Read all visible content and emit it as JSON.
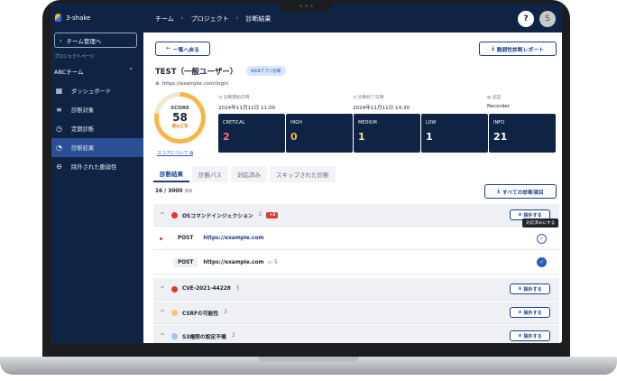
{
  "app": {
    "name": "3-shake"
  },
  "sidebar": {
    "back_label": "チーム管理へ",
    "project_page_label": "プロジェクトページ",
    "team_name": "ABCチーム",
    "items": [
      {
        "label": "ダッシュボード",
        "icon": "dashboard-icon"
      },
      {
        "label": "診断対象",
        "icon": "target-list-icon"
      },
      {
        "label": "定期診断",
        "icon": "clock-icon"
      },
      {
        "label": "診断結果",
        "icon": "pie-chart-icon",
        "active": true
      },
      {
        "label": "除外された脆弱性",
        "icon": "minus-circle-icon"
      }
    ]
  },
  "header": {
    "breadcrumb": [
      "チーム",
      "プロジェクト",
      "診断結果"
    ],
    "help": "?",
    "avatar": "S"
  },
  "main": {
    "back_button": "一覧へ戻る",
    "report_button": "脆弱性診断レポート",
    "title": "TEST（一般ユーザー）",
    "tag": "WEBアプリ診断",
    "url": "https://example.com/login",
    "score": {
      "label": "SCORE",
      "value": "58",
      "status": "概ね正常",
      "link": "スコアについて",
      "fraction": 0.78
    },
    "meta": [
      {
        "key": "診断開始日時",
        "value": "2024年11月11日 11:00"
      },
      {
        "key": "診断終了日時",
        "value": "2024年11月11日 14:30"
      },
      {
        "key": "認証",
        "value": "Recorder"
      }
    ],
    "severity": [
      {
        "name": "CRETICAL",
        "count": "2",
        "color": "#ff6f7a"
      },
      {
        "name": "HIGH",
        "count": "0",
        "color": "#f7b64a"
      },
      {
        "name": "MEDIUM",
        "count": "1",
        "color": "#f7e08a"
      },
      {
        "name": "LOW",
        "count": "1",
        "color": "#ffffff"
      },
      {
        "name": "INFO",
        "count": "21",
        "color": "#ffffff"
      }
    ],
    "tabs": [
      "診断結果",
      "診断パス",
      "対応済み",
      "スキップされた診断"
    ],
    "count_text": "16 / 3000",
    "count_unit": "項目",
    "all_items_button": "すべての診断項目",
    "exclude_label": "除外する",
    "tooltip": "対応済みにする",
    "groups": [
      {
        "name": "OSコマンドインジェクション",
        "count": "2",
        "badge": "+2",
        "color": "#e03a2f"
      },
      {
        "name": "CVE-2021-44228",
        "count": "5",
        "color": "#e03a2f"
      },
      {
        "name": "CSRFの可能性",
        "count": "3",
        "color": "#f7c56b"
      },
      {
        "name": "S3権限の設定不備",
        "count": "3",
        "color": "#9cc4f3"
      }
    ],
    "entries": [
      {
        "method": "POST",
        "url": "https://example.com",
        "comments": ""
      },
      {
        "method": "POST",
        "url": "https://example.com",
        "comments": "5"
      }
    ]
  }
}
